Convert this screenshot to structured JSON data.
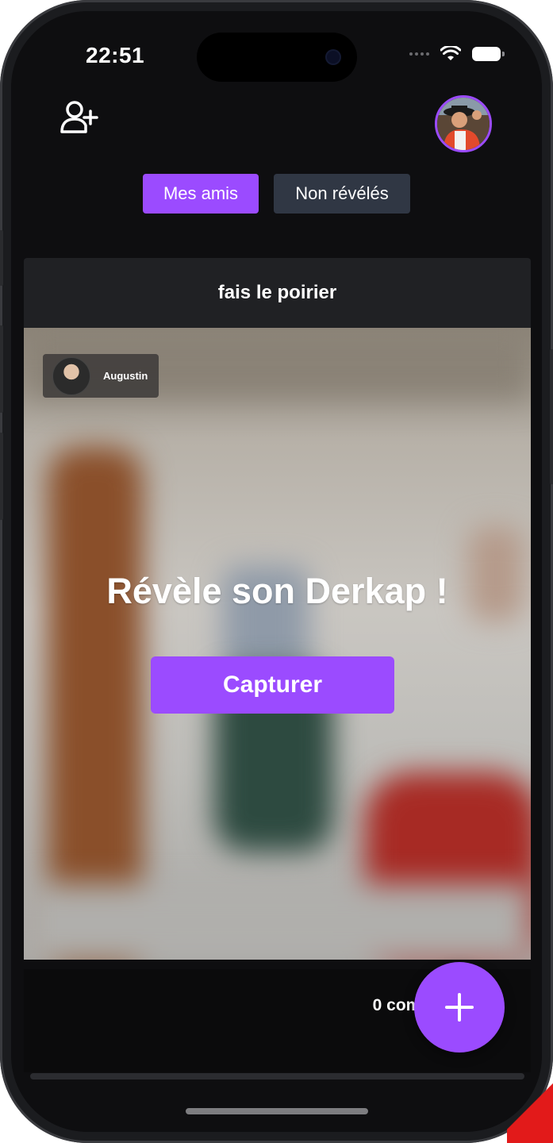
{
  "status_bar": {
    "time": "22:51"
  },
  "header": {
    "add_friend_icon": "user-plus-icon",
    "profile_avatar": "profile-photo"
  },
  "tabs": [
    {
      "label": "Mes amis",
      "active": true
    },
    {
      "label": "Non révélés",
      "active": false
    }
  ],
  "post": {
    "challenge": "fais le poirier",
    "author": "Augustin",
    "reveal_text": "Révèle son Derkap !",
    "capture_label": "Capturer",
    "comments": "0 comm"
  },
  "fab": {
    "icon": "plus-icon"
  },
  "colors": {
    "accent": "#9b4bff",
    "background": "#0e0e10",
    "inactive_tab": "#303744"
  }
}
